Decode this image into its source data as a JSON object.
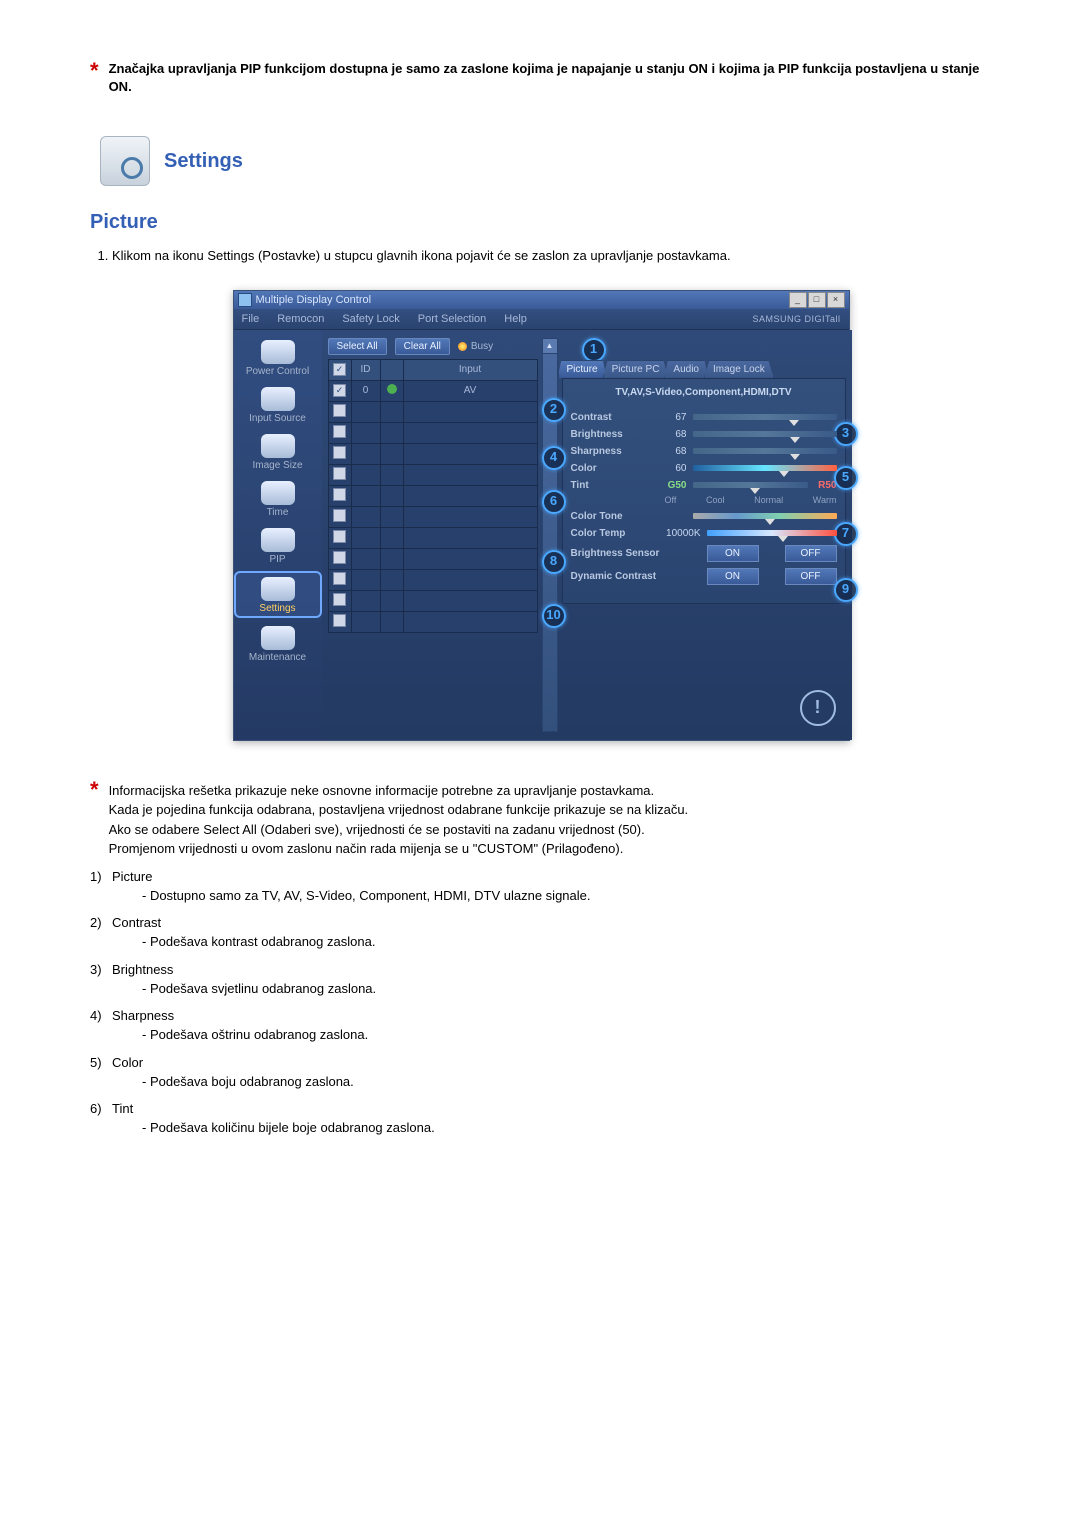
{
  "top_note": "Značajka upravljanja PIP funkcijom dostupna je samo za zaslone kojima je napajanje u stanju ON i kojima ja PIP funkcija postavljena u stanje ON.",
  "settings_heading": "Settings",
  "picture_heading": "Picture",
  "intro_list_item": "Klikom na ikonu Settings (Postavke) u stupcu glavnih ikona pojavit će se zaslon za upravljanje postavkama.",
  "app": {
    "title": "Multiple Display Control",
    "menu": [
      "File",
      "Remocon",
      "Safety Lock",
      "Port Selection",
      "Help"
    ],
    "branding": "SAMSUNG DIGITall",
    "sidebar": [
      "Power Control",
      "Input Source",
      "Image Size",
      "Time",
      "PIP",
      "Settings",
      "Maintenance"
    ],
    "sidebar_active_index": 5,
    "buttons": {
      "select_all": "Select All",
      "clear_all": "Clear All",
      "busy": "Busy"
    },
    "table": {
      "headers": [
        "",
        "ID",
        "",
        "Input"
      ],
      "row1_id": "0",
      "row1_input": "AV"
    },
    "tabs": [
      "Picture",
      "Picture PC",
      "Audio",
      "Image Lock"
    ],
    "tabs_active_index": 0,
    "panel_subtitle": "TV,AV,S-Video,Component,HDMI,DTV",
    "sliders": {
      "contrast": {
        "label": "Contrast",
        "value": "67"
      },
      "brightness": {
        "label": "Brightness",
        "value": "68"
      },
      "sharpness": {
        "label": "Sharpness",
        "value": "68"
      },
      "color": {
        "label": "Color",
        "value": "60"
      },
      "tint": {
        "label": "Tint",
        "left": "G50",
        "right": "R50"
      },
      "colortone": {
        "label": "Color Tone",
        "options": [
          "Off",
          "Cool",
          "Normal",
          "Warm"
        ]
      },
      "colortemp": {
        "label": "Color Temp",
        "value": "10000K"
      },
      "bsense": {
        "label": "Brightness Sensor",
        "on": "ON",
        "off": "OFF"
      },
      "dyncon": {
        "label": "Dynamic Contrast",
        "on": "ON",
        "off": "OFF"
      }
    }
  },
  "star_paragraph": [
    "Informacijska rešetka prikazuje neke osnovne informacije potrebne za upravljanje postavkama.",
    "Kada je pojedina funkcija odabrana, postavljena vrijednost odabrane funkcije prikazuje se na klizaču.",
    "Ako se odabere Select All (Odaberi sve), vrijednosti će se postaviti na zadanu vrijednost (50).",
    "Promjenom vrijednosti u ovom zaslonu način rada mijenja se u \"CUSTOM\" (Prilagođeno)."
  ],
  "numbered": [
    {
      "n": "1)",
      "title": "Picture",
      "sub": "- Dostupno samo za TV, AV, S-Video, Component, HDMI, DTV ulazne signale."
    },
    {
      "n": "2)",
      "title": "Contrast",
      "sub": "- Podešava kontrast odabranog zaslona."
    },
    {
      "n": "3)",
      "title": "Brightness",
      "sub": "- Podešava svjetlinu odabranog zaslona."
    },
    {
      "n": "4)",
      "title": "Sharpness",
      "sub": "- Podešava oštrinu odabranog zaslona."
    },
    {
      "n": "5)",
      "title": "Color",
      "sub": "- Podešava boju odabranog zaslona."
    },
    {
      "n": "6)",
      "title": "Tint",
      "sub": "- Podešava količinu bijele boje odabranog zaslona."
    }
  ]
}
